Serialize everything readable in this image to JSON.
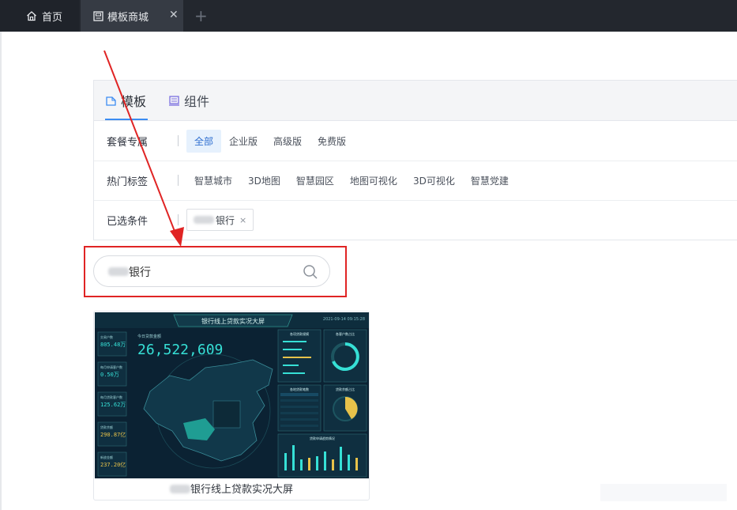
{
  "tabs": [
    {
      "label": "首页",
      "icon": "home-icon"
    },
    {
      "label": "模板商城",
      "icon": "store-icon",
      "close": "✕"
    }
  ],
  "add_tab": "+",
  "panel": {
    "tabs": [
      {
        "label": "模板",
        "icon": "template-icon",
        "active": true
      },
      {
        "label": "组件",
        "icon": "component-icon",
        "active": false
      }
    ],
    "plan_row": {
      "label": "套餐专属",
      "options": [
        "全部",
        "企业版",
        "高级版",
        "免费版"
      ],
      "selected": "全部"
    },
    "hot_tags_row": {
      "label": "热门标签",
      "tags": [
        "智慧城市",
        "3D地图",
        "智慧园区",
        "地图可视化",
        "3D可视化",
        "智慧党建"
      ]
    },
    "selected_row": {
      "label": "已选条件",
      "chip_text": "银行",
      "chip_close": "×"
    }
  },
  "search": {
    "value": "银行",
    "icon": "search-icon"
  },
  "card": {
    "title": "银行线上贷款实况大屏",
    "thumb": {
      "header": "银行线上贷款实况大屏",
      "datetime": "2021-09-14 09:15:28",
      "big_label": "今日贷款金额",
      "big_number": "26,522,609",
      "left_panels": [
        {
          "label": "交易户数",
          "value": "805.48万"
        },
        {
          "label": "每月申请客户数",
          "value": "0.50万"
        },
        {
          "label": "每月贷款客户数",
          "value": "125.62万"
        },
        {
          "label": "贷款余额",
          "value": "290.87亿"
        },
        {
          "label": "新放金额",
          "value": "237.20亿"
        }
      ],
      "right_top_left": "各项贷款规模",
      "right_top_right": "各客户数占比",
      "right_mid_left": "各地贷款笔数",
      "right_mid_right": "贷款余额占比",
      "right_bottom": "贷款申请趋势情况"
    }
  },
  "colors": {
    "accent": "#3b8cf2",
    "annotation_red": "#e02424",
    "topbar": "#23272e",
    "thumb_bg": "#0b2233",
    "thumb_cyan": "#36e0d6",
    "thumb_gold": "#e7c24a"
  }
}
